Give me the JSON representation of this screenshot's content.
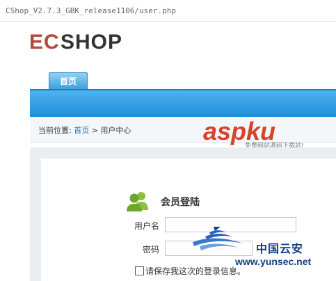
{
  "browser": {
    "url": "CShop_V2.7.3_GBK_release1106/user.php"
  },
  "logo": {
    "part1": "EC",
    "part2": "SHOP"
  },
  "nav": {
    "home_tab": "首页"
  },
  "breadcrumb": {
    "prefix": "当前位置:",
    "home": "首页",
    "separator": ">",
    "current": "用户中心"
  },
  "watermark_asp": {
    "main": "aspku",
    "sub": "免费网站源码下载站!"
  },
  "login": {
    "title": "会员登陆",
    "username_label": "用户名",
    "password_label": "密码",
    "remember_label": "请保存我这次的登录信息。",
    "avatar_icon": "users-icon"
  },
  "watermark_yun": {
    "title": "中国云安",
    "url": "www.yunsec.net"
  },
  "colors": {
    "nav_blue": "#1f8fd9",
    "logo_red": "#b14a3c",
    "watermark_red": "#d9412a",
    "brand_navy": "#123f85"
  }
}
